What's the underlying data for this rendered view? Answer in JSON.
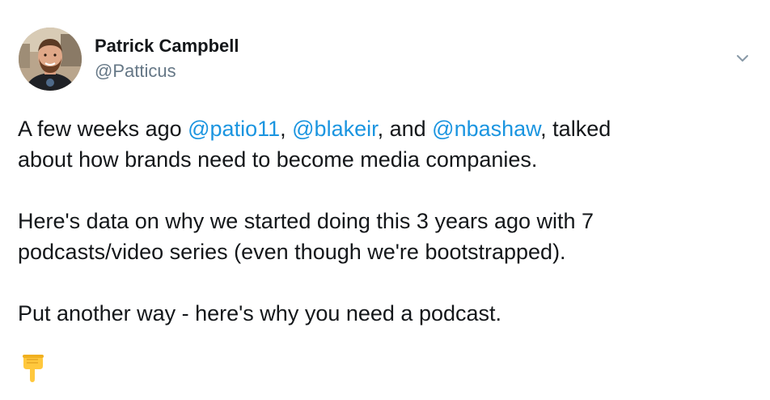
{
  "author": {
    "display_name": "Patrick Campbell",
    "handle": "@Patticus"
  },
  "tweet": {
    "line1": {
      "prefix": "A few weeks ago ",
      "mention1": "@patio11",
      "sep1": ", ",
      "mention2": "@blakeir",
      "sep2": ", and ",
      "mention3": "@nbashaw",
      "suffix": ", talked"
    },
    "line2": "about how brands need to become media companies.",
    "line3": "Here's data on why we started doing this 3 years ago with 7",
    "line4": "podcasts/video series (even though we're bootstrapped).",
    "line5": "Put another way - here's why you need a podcast.",
    "emoji": "backhand-index-pointing-down"
  },
  "colors": {
    "link": "#1b95e0",
    "text": "#14171a",
    "secondary": "#657786"
  },
  "icons": {
    "caret": "chevron-down-icon"
  }
}
